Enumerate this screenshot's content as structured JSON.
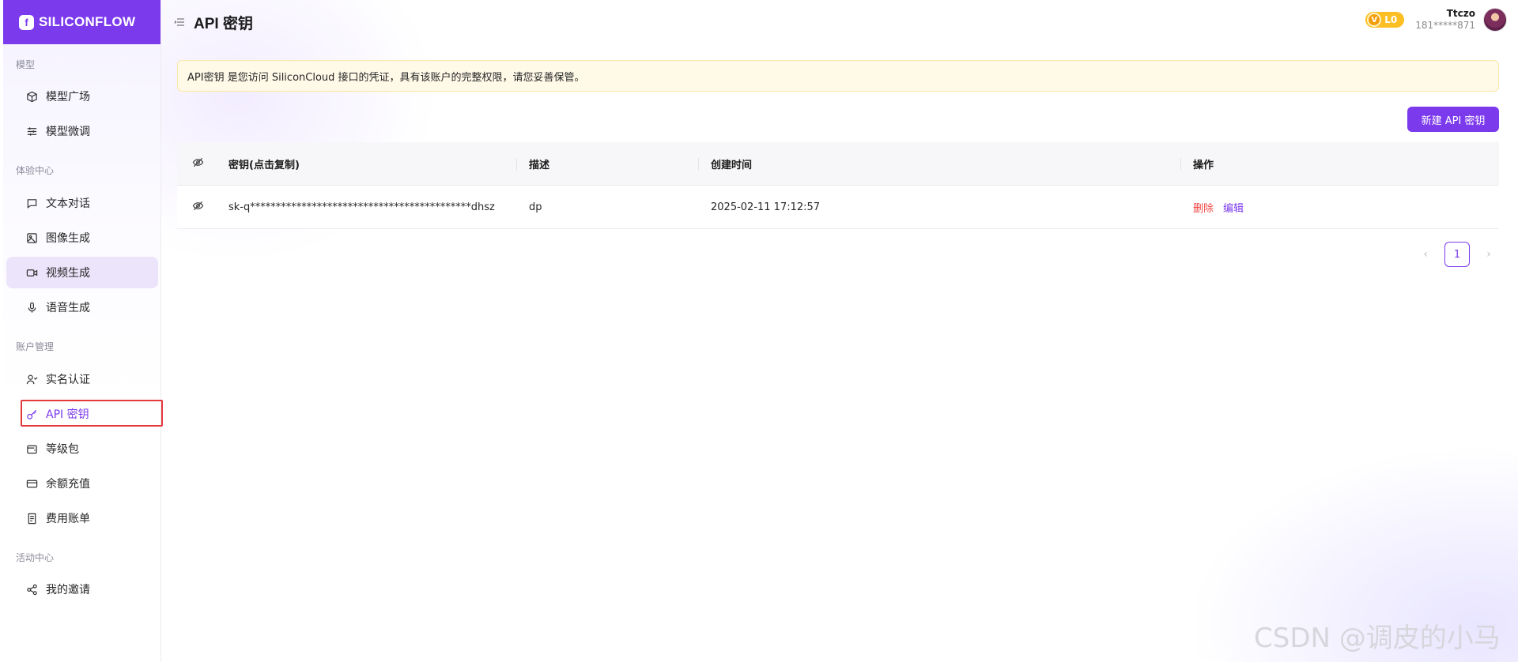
{
  "brand": {
    "name": "SILICONFLOW",
    "accent": "#7c3aed"
  },
  "header": {
    "title": "API 密钥"
  },
  "user": {
    "level": "L0",
    "level_mark": "V",
    "name": "Ttczo",
    "phone": "181*****871"
  },
  "sidebar": {
    "groups": [
      {
        "title": "模型",
        "items": [
          {
            "label": "模型广场",
            "icon": "cube-icon"
          },
          {
            "label": "模型微调",
            "icon": "sliders-icon"
          }
        ]
      },
      {
        "title": "体验中心",
        "items": [
          {
            "label": "文本对话",
            "icon": "chat-icon"
          },
          {
            "label": "图像生成",
            "icon": "image-icon"
          },
          {
            "label": "视频生成",
            "icon": "video-icon"
          },
          {
            "label": "语音生成",
            "icon": "mic-icon"
          }
        ]
      },
      {
        "title": "账户管理",
        "items": [
          {
            "label": "实名认证",
            "icon": "user-check-icon"
          },
          {
            "label": "API 密钥",
            "icon": "key-icon"
          },
          {
            "label": "等级包",
            "icon": "wallet-icon"
          },
          {
            "label": "余额充值",
            "icon": "credit-card-icon"
          },
          {
            "label": "费用账单",
            "icon": "receipt-icon"
          }
        ]
      },
      {
        "title": "活动中心",
        "items": [
          {
            "label": "我的邀请",
            "icon": "share-icon"
          }
        ]
      }
    ]
  },
  "notice": {
    "text": "API密钥 是您访问 SiliconCloud 接口的凭证，具有该账户的完整权限，请您妥善保管。"
  },
  "actions": {
    "new_key_label": "新建 API 密钥"
  },
  "table": {
    "headers": {
      "key": "密钥(点击复制)",
      "description": "描述",
      "created": "创建时间",
      "ops": "操作"
    },
    "rows": [
      {
        "key": "sk-q*******************************************dhsz",
        "description": "dp",
        "created": "2025-02-11 17:12:57",
        "delete_label": "删除",
        "edit_label": "编辑"
      }
    ]
  },
  "pagination": {
    "current_page": "1",
    "prev": "‹",
    "next": "›"
  },
  "watermark": "CSDN @调皮的小马"
}
